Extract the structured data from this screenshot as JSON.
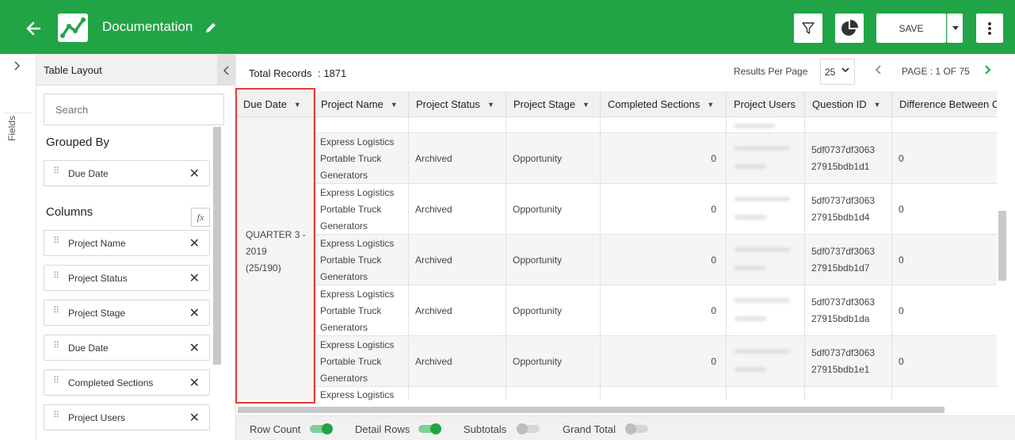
{
  "header": {
    "title": "Documentation",
    "save_label": "SAVE"
  },
  "sidebar": {
    "fields_label": "Fields",
    "panel_title": "Table Layout",
    "search_placeholder": "Search",
    "grouped_by_title": "Grouped By",
    "grouped_by": [
      {
        "label": "Due Date"
      }
    ],
    "columns_title": "Columns",
    "fx_label": "fx",
    "columns": [
      {
        "label": "Project Name"
      },
      {
        "label": "Project Status"
      },
      {
        "label": "Project Stage"
      },
      {
        "label": "Due Date"
      },
      {
        "label": "Completed Sections"
      },
      {
        "label": "Project Users"
      }
    ]
  },
  "toolbar": {
    "total_records_label": "Total Records",
    "total_records_value": ": 1871",
    "results_per_page_label": "Results Per Page",
    "results_per_page_value": "25",
    "page_label": "PAGE : 1 OF 75"
  },
  "table": {
    "headers": [
      "Due Date",
      "Project Name",
      "Project Status",
      "Project Stage",
      "Completed Sections",
      "Project Users",
      "Question ID",
      "Difference Between C"
    ],
    "group_label": [
      "QUARTER 3 -",
      "2019",
      "(25/190)"
    ],
    "rows": [
      {
        "name": [
          "Express Logistics",
          "Portable Truck",
          "Generators"
        ],
        "status": "Archived",
        "stage": "Opportunity",
        "completed": "0",
        "qid": [
          "5df0737df3063",
          "27915bdb1d1"
        ],
        "diff": "0"
      },
      {
        "name": [
          "Express Logistics",
          "Portable Truck",
          "Generators"
        ],
        "status": "Archived",
        "stage": "Opportunity",
        "completed": "0",
        "qid": [
          "5df0737df3063",
          "27915bdb1d4"
        ],
        "diff": "0"
      },
      {
        "name": [
          "Express Logistics",
          "Portable Truck",
          "Generators"
        ],
        "status": "Archived",
        "stage": "Opportunity",
        "completed": "0",
        "qid": [
          "5df0737df3063",
          "27915bdb1d7"
        ],
        "diff": "0"
      },
      {
        "name": [
          "Express Logistics",
          "Portable Truck",
          "Generators"
        ],
        "status": "Archived",
        "stage": "Opportunity",
        "completed": "0",
        "qid": [
          "5df0737df3063",
          "27915bdb1da"
        ],
        "diff": "0"
      },
      {
        "name": [
          "Express Logistics",
          "Portable Truck",
          "Generators"
        ],
        "status": "Archived",
        "stage": "Opportunity",
        "completed": "0",
        "qid": [
          "5df0737df3063",
          "27915bdb1e1"
        ],
        "diff": "0"
      }
    ],
    "partial_row_name": "Express Logistics"
  },
  "footer": {
    "toggles": [
      {
        "label": "Row Count",
        "on": true
      },
      {
        "label": "Detail Rows",
        "on": true
      },
      {
        "label": "Subtotals",
        "on": false
      },
      {
        "label": "Grand Total",
        "on": false
      }
    ]
  },
  "colors": {
    "brand": "#21a446",
    "highlight": "#e53935"
  }
}
